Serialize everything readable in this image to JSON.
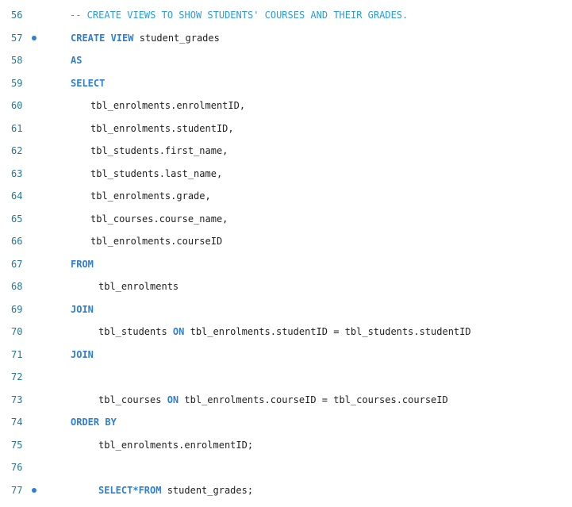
{
  "editor": {
    "lines": [
      {
        "number": "56",
        "breakpoint": false,
        "indent": "comment",
        "tokens": [
          {
            "type": "comment",
            "text": "-- CREATE VIEWS TO SHOW STUDENTS' COURSES AND THEIR GRADES."
          }
        ]
      },
      {
        "number": "57",
        "breakpoint": true,
        "indent": "base",
        "tokens": [
          {
            "type": "kw",
            "text": "CREATE VIEW"
          },
          {
            "type": "text",
            "text": " student_grades"
          }
        ]
      },
      {
        "number": "58",
        "breakpoint": false,
        "indent": "base",
        "tokens": [
          {
            "type": "kw",
            "text": "AS"
          }
        ]
      },
      {
        "number": "59",
        "breakpoint": false,
        "indent": "base",
        "tokens": [
          {
            "type": "kw",
            "text": "SELECT"
          }
        ]
      },
      {
        "number": "60",
        "breakpoint": false,
        "indent": "field",
        "tokens": [
          {
            "type": "text",
            "text": "tbl_enrolments.enrolmentID,"
          }
        ]
      },
      {
        "number": "61",
        "breakpoint": false,
        "indent": "field",
        "tokens": [
          {
            "type": "text",
            "text": "tbl_enrolments.studentID,"
          }
        ]
      },
      {
        "number": "62",
        "breakpoint": false,
        "indent": "field",
        "tokens": [
          {
            "type": "text",
            "text": "tbl_students.first_name,"
          }
        ]
      },
      {
        "number": "63",
        "breakpoint": false,
        "indent": "field",
        "tokens": [
          {
            "type": "text",
            "text": "tbl_students.last_name,"
          }
        ]
      },
      {
        "number": "64",
        "breakpoint": false,
        "indent": "field",
        "tokens": [
          {
            "type": "text",
            "text": "tbl_enrolments.grade,"
          }
        ]
      },
      {
        "number": "65",
        "breakpoint": false,
        "indent": "field",
        "tokens": [
          {
            "type": "text",
            "text": "tbl_courses.course_name,"
          }
        ]
      },
      {
        "number": "66",
        "breakpoint": false,
        "indent": "field",
        "tokens": [
          {
            "type": "text",
            "text": "tbl_enrolments.courseID"
          }
        ]
      },
      {
        "number": "67",
        "breakpoint": false,
        "indent": "base",
        "tokens": [
          {
            "type": "kw",
            "text": "FROM"
          }
        ]
      },
      {
        "number": "68",
        "breakpoint": false,
        "indent": "clause",
        "tokens": [
          {
            "type": "text",
            "text": "tbl_enrolments"
          }
        ]
      },
      {
        "number": "69",
        "breakpoint": false,
        "indent": "base",
        "tokens": [
          {
            "type": "kw",
            "text": "JOIN"
          }
        ]
      },
      {
        "number": "70",
        "breakpoint": false,
        "indent": "clause",
        "tokens": [
          {
            "type": "text",
            "text": "tbl_students "
          },
          {
            "type": "kw",
            "text": "ON"
          },
          {
            "type": "text",
            "text": " tbl_enrolments.studentID = tbl_students.studentID"
          }
        ]
      },
      {
        "number": "71",
        "breakpoint": false,
        "indent": "base",
        "tokens": [
          {
            "type": "kw",
            "text": "JOIN"
          }
        ]
      },
      {
        "number": "72",
        "breakpoint": false,
        "indent": "base",
        "tokens": []
      },
      {
        "number": "73",
        "breakpoint": false,
        "indent": "clause",
        "tokens": [
          {
            "type": "text",
            "text": "tbl_courses "
          },
          {
            "type": "kw",
            "text": "ON"
          },
          {
            "type": "text",
            "text": " tbl_enrolments.courseID = tbl_courses.courseID"
          }
        ]
      },
      {
        "number": "74",
        "breakpoint": false,
        "indent": "base",
        "tokens": [
          {
            "type": "kw",
            "text": "ORDER BY"
          }
        ]
      },
      {
        "number": "75",
        "breakpoint": false,
        "indent": "clause",
        "tokens": [
          {
            "type": "text",
            "text": "tbl_enrolments.enrolmentID;"
          }
        ]
      },
      {
        "number": "76",
        "breakpoint": false,
        "indent": "base",
        "tokens": []
      },
      {
        "number": "77",
        "breakpoint": true,
        "indent": "clause",
        "tokens": [
          {
            "type": "kw",
            "text": "SELECT*FROM"
          },
          {
            "type": "text",
            "text": " student_grades;"
          }
        ]
      }
    ]
  }
}
